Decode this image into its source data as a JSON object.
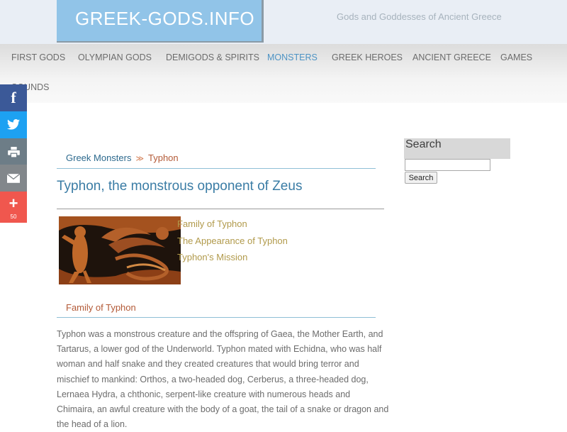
{
  "header": {
    "logo_text": "GREEK-GODS.INFO",
    "tagline": "Gods and Goddesses of Ancient Greece"
  },
  "nav": {
    "items": [
      {
        "label": "FIRST GODS",
        "active": false
      },
      {
        "label": "OLYMPIAN GODS",
        "active": false
      },
      {
        "label": "DEMIGODS & SPIRITS",
        "active": false
      },
      {
        "label": "MONSTERS",
        "active": true
      },
      {
        "label": "GREEK HEROES",
        "active": false
      },
      {
        "label": "ANCIENT GREECE",
        "active": false
      },
      {
        "label": "GAMES",
        "active": false
      },
      {
        "label": "SOUNDS",
        "active": false
      }
    ]
  },
  "social": {
    "facebook_icon": "f",
    "twitter_icon": "twitter-bird",
    "print_icon": "printer",
    "email_icon": "envelope",
    "share_icon": "+",
    "share_count": "50"
  },
  "breadcrumb": {
    "parent": "Greek Monsters",
    "separator": "≫",
    "current": "Typhon"
  },
  "article": {
    "title": "Typhon, the monstrous opponent of Zeus",
    "toc": [
      "Family of Typhon",
      "The Appearance of Typhon",
      "Typhon's Mission"
    ],
    "section_heading": "Family of Typhon",
    "paragraph": "Typhon was a monstrous creature and the offspring of Gaea, the Mother Earth, and Tartarus, a lower god of the Underworld. Typhon mated with Echidna, who was half woman and half snake and they created creatures that would bring terror and mischief to mankind: Orthos, a two-headed dog, Cerberus, a three-headed dog, Lernaea Hydra, a chthonic, serpent-like creature with numerous heads and Chimaira, an awful creature with the body of a goat, the tail of a snake or dragon and the head of a lion."
  },
  "sidebar": {
    "search_title": "Search",
    "search_value": "",
    "search_button": "Search"
  },
  "colors": {
    "logo_bg": "#91c4e8",
    "nav_active": "#4d93c4",
    "link_gold": "#b19a4b",
    "accent_rust": "#b35a37"
  }
}
